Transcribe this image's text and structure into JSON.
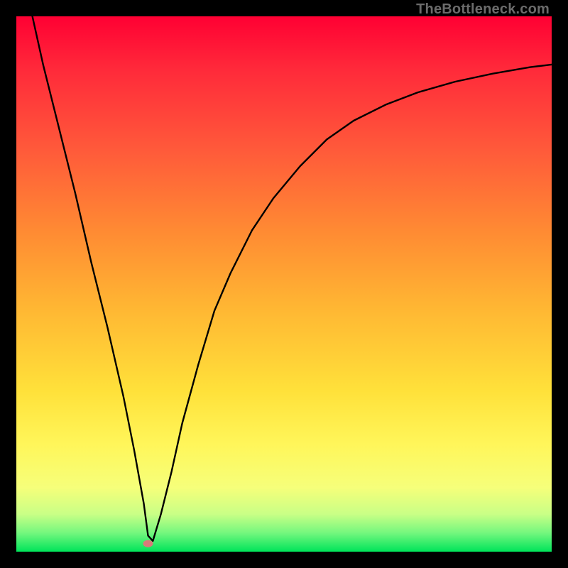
{
  "watermark": "TheBottleneck.com",
  "chart_data": {
    "type": "line",
    "title": "",
    "xlabel": "",
    "ylabel": "",
    "xlim": [
      0,
      100
    ],
    "ylim": [
      0,
      100
    ],
    "grid": false,
    "legend": false,
    "series": [
      {
        "name": "bottleneck-curve",
        "x": [
          3,
          5,
          8,
          11,
          14,
          17,
          20,
          22,
          23.8,
          24.6,
          25.5,
          27,
          29,
          31,
          34,
          37,
          40,
          44,
          48,
          53,
          58,
          63,
          69,
          75,
          82,
          89,
          96,
          100
        ],
        "y": [
          100,
          91,
          79,
          67,
          54,
          42,
          29,
          19,
          9,
          3,
          2,
          7,
          15,
          24,
          35,
          45,
          52,
          60,
          66,
          72,
          77,
          80.5,
          83.5,
          85.8,
          87.8,
          89.3,
          90.5,
          91
        ]
      }
    ],
    "marker": {
      "name": "optimal-point",
      "x": 24.6,
      "y": 1.5,
      "color": "#d97a7a"
    },
    "gradient_stops": [
      {
        "offset": 0.0,
        "color": "#ff0033"
      },
      {
        "offset": 0.1,
        "color": "#ff2a3a"
      },
      {
        "offset": 0.25,
        "color": "#ff5a3a"
      },
      {
        "offset": 0.4,
        "color": "#ff8a33"
      },
      {
        "offset": 0.55,
        "color": "#ffb833"
      },
      {
        "offset": 0.7,
        "color": "#ffe13a"
      },
      {
        "offset": 0.8,
        "color": "#fff65a"
      },
      {
        "offset": 0.88,
        "color": "#f6ff7a"
      },
      {
        "offset": 0.93,
        "color": "#c9ff86"
      },
      {
        "offset": 0.965,
        "color": "#74f77e"
      },
      {
        "offset": 1.0,
        "color": "#00e45a"
      }
    ]
  }
}
